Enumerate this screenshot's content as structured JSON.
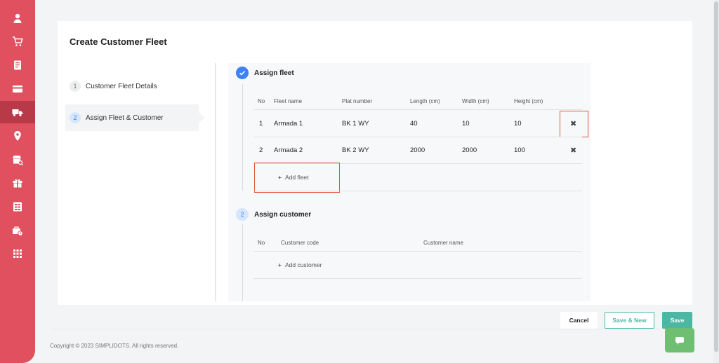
{
  "sidebar": {
    "items": [
      {
        "icon": "user-icon"
      },
      {
        "icon": "cart-icon"
      },
      {
        "icon": "document-icon"
      },
      {
        "icon": "card-icon"
      },
      {
        "icon": "truck-icon",
        "active": true
      },
      {
        "icon": "location-pin-icon"
      },
      {
        "icon": "store-search-icon"
      },
      {
        "icon": "gift-icon"
      },
      {
        "icon": "table-icon"
      },
      {
        "icon": "briefcase-clock-icon"
      },
      {
        "icon": "apps-grid-icon"
      }
    ]
  },
  "page": {
    "title": "Create Customer Fleet"
  },
  "steps": [
    {
      "number": "1",
      "label": "Customer Fleet Details"
    },
    {
      "number": "2",
      "label": "Assign Fleet & Customer"
    }
  ],
  "assign_fleet": {
    "title": "Assign fleet",
    "columns": [
      "No",
      "Fleet name",
      "Plat number",
      "Length (cm)",
      "Width (cm)",
      "Height (cm)"
    ],
    "rows": [
      {
        "no": "1",
        "fleet_name": "Armada 1",
        "plat_number": "BK 1 WY",
        "length": "40",
        "width": "10",
        "height": "10"
      },
      {
        "no": "2",
        "fleet_name": "Armada 2",
        "plat_number": "BK 2 WY",
        "length": "2000",
        "width": "2000",
        "height": "100"
      }
    ],
    "add_label": "Add fleet"
  },
  "assign_customer": {
    "number": "2",
    "title": "Assign customer",
    "columns": [
      "No",
      "Customer code",
      "Customer name"
    ],
    "add_label": "Add customer"
  },
  "footer": {
    "cancel_label": "Cancel",
    "save_new_label": "Save & New",
    "save_label": "Save",
    "copyright": "Copyright © 2023 SIMPLIDOTS. All rights reserved."
  },
  "colors": {
    "sidebar": "#e0505f",
    "accent": "#4cb8a4",
    "step_blue": "#3b82f6",
    "highlight_box": "#e4533b"
  }
}
